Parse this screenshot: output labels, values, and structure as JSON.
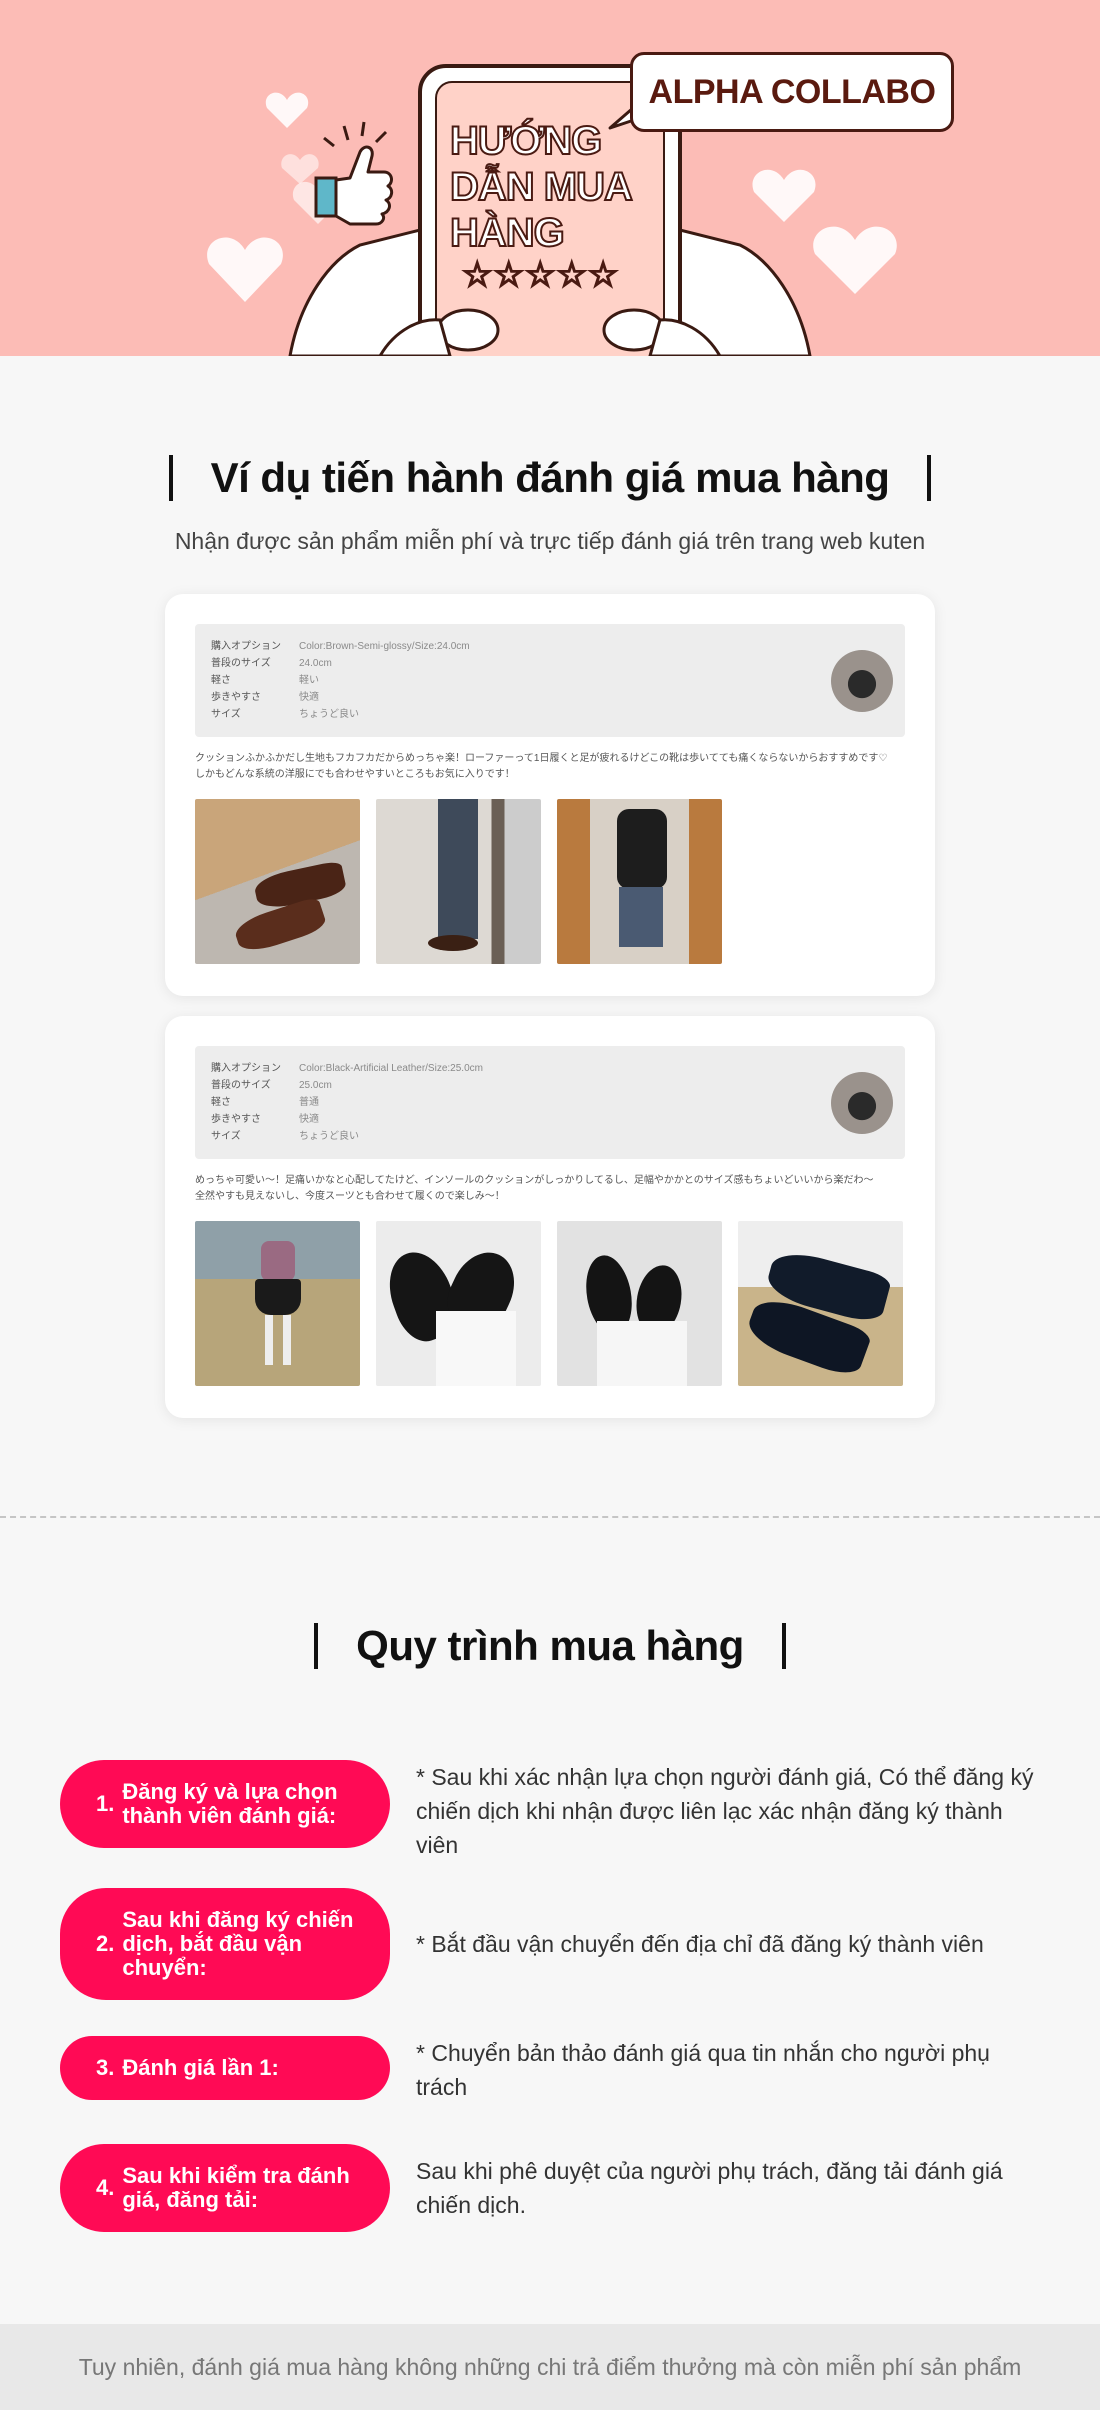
{
  "hero": {
    "title": "HƯỚNG DẪN MUA HÀNG",
    "badge": "ALPHA COLLABO",
    "stars": "☆☆☆☆☆"
  },
  "example_section": {
    "heading": "Ví dụ tiến hành đánh giá mua hàng",
    "subtitle": "Nhận được sản phẩm miễn phí và trực tiếp đánh giá trên trang web kuten"
  },
  "reviews": [
    {
      "options": [
        {
          "key": "購入オプション",
          "value": "Color:Brown-Semi-glossy/Size:24.0cm"
        },
        {
          "key": "普段のサイズ",
          "value": "24.0cm"
        },
        {
          "key": "軽さ",
          "value": "軽い"
        },
        {
          "key": "歩きやすさ",
          "value": "快適"
        },
        {
          "key": "サイズ",
          "value": "ちょうど良い"
        }
      ],
      "text_line1": "クッションふかふかだし生地もフカフカだからめっちゃ楽！ローファーって1日履くと足が疲れるけどこの靴は歩いてても痛くならないからおすすめです♡",
      "text_line2": "しかもどんな系統の洋服にでも合わせやすいところもお気に入りです！"
    },
    {
      "options": [
        {
          "key": "購入オプション",
          "value": "Color:Black-Artificial Leather/Size:25.0cm"
        },
        {
          "key": "普段のサイズ",
          "value": "25.0cm"
        },
        {
          "key": "軽さ",
          "value": "普通"
        },
        {
          "key": "歩きやすさ",
          "value": "快適"
        },
        {
          "key": "サイズ",
          "value": "ちょうど良い"
        }
      ],
      "text_line1": "めっちゃ可愛い～！足痛いかなと心配してたけど、インソールのクッションがしっかりしてるし、足幅やかかとのサイズ感もちょいどいいから楽だわ～",
      "text_line2": "全然やすも見えないし、今度スーツとも合わせて履くので楽しみ～！"
    }
  ],
  "process_section": {
    "heading": "Quy trình mua hàng",
    "steps": [
      {
        "number": "1.",
        "label": "Đăng ký và lựa chọn thành viên đánh giá:",
        "description": "* Sau khi xác nhận lựa chọn người đánh giá, Có thể đăng ký chiến dịch khi nhận được liên lạc xác nhận đăng ký thành viên"
      },
      {
        "number": "2.",
        "label": "Sau khi đăng ký chiến dịch, bắt đầu vận chuyển:",
        "description": "* Bắt đầu vận chuyển đến địa chỉ đã đăng ký thành viên"
      },
      {
        "number": "3.",
        "label": "Đánh giá lần 1:",
        "description": "* Chuyển bản thảo đánh giá qua tin nhắn cho người phụ trách"
      },
      {
        "number": "4.",
        "label": "Sau khi kiểm tra đánh giá, đăng tải:",
        "description": "Sau khi phê duyệt của người phụ trách, đăng tải đánh giá chiến dịch."
      }
    ]
  },
  "footer": {
    "text": "Tuy nhiên, đánh giá mua hàng không những chi trả điểm thưởng mà còn miễn phí sản phẩm"
  },
  "colors": {
    "hero_bg": "#fcbcb6",
    "accent": "#ff0a55",
    "dark_brown": "#4a1a12"
  }
}
